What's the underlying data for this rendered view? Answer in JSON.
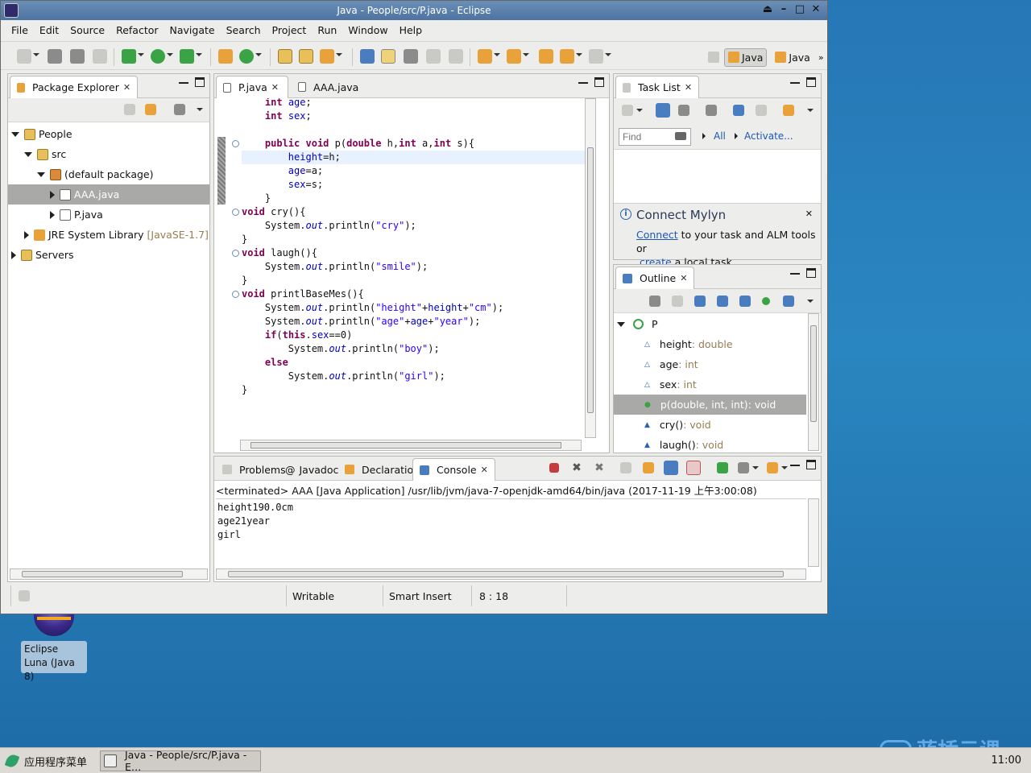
{
  "window": {
    "title": "Java - People/src/P.java - Eclipse",
    "controls": [
      "⏏",
      "–",
      "□",
      "✕"
    ]
  },
  "menu": [
    {
      "label": "File"
    },
    {
      "label": "Edit"
    },
    {
      "label": "Source"
    },
    {
      "label": "Refactor"
    },
    {
      "label": "Navigate"
    },
    {
      "label": "Search"
    },
    {
      "label": "Project"
    },
    {
      "label": "Run"
    },
    {
      "label": "Window"
    },
    {
      "label": "Help"
    }
  ],
  "perspectives": {
    "java_1": "Java",
    "java_2": "Java"
  },
  "package_explorer": {
    "title": "Package Explorer",
    "tree": {
      "project": "People",
      "src": "src",
      "package": "(default package)",
      "file_aaa": "AAA.java",
      "file_p": "P.java",
      "jre": "JRE System Library",
      "jre_version": "[JavaSE-1.7]",
      "servers": "Servers"
    }
  },
  "editor": {
    "tabs": [
      {
        "label": "P.java",
        "active": true
      },
      {
        "label": "AAA.java",
        "active": false
      }
    ],
    "lines": [
      "    int age;",
      "    int sex;",
      "",
      "    public void p(double h,int a,int s){",
      "        height=h;",
      "        age=a;",
      "        sex=s;",
      "    }",
      "void cry(){",
      "    System.out.println(\"cry\");",
      "}",
      "void laugh(){",
      "    System.out.println(\"smile\");",
      "}",
      "void printlBaseMes(){",
      "    System.out.println(\"height\"+height+\"cm\");",
      "    System.out.println(\"age\"+age+\"year\");",
      "    if(this.sex==0)",
      "        System.out.println(\"boy\");",
      "    else",
      "        System.out.println(\"girl\");",
      "}"
    ]
  },
  "task_list": {
    "title": "Task List",
    "find_placeholder": "Find",
    "all": "All",
    "activate": "Activate...",
    "mylyn": {
      "heading": "Connect Mylyn",
      "connect": "Connect",
      "text1": " to your task and ALM tools or",
      "create": "create",
      "text2": " a local task."
    }
  },
  "outline": {
    "title": "Outline",
    "class_name": "P",
    "members": [
      {
        "name": "height",
        "type": " : double"
      },
      {
        "name": "age",
        "type": " : int"
      },
      {
        "name": "sex",
        "type": " : int"
      },
      {
        "name": "p(double, int, int)",
        "type": " : void"
      },
      {
        "name": "cry()",
        "type": " : void"
      },
      {
        "name": "laugh()",
        "type": " : void"
      }
    ]
  },
  "bottom_tabs": {
    "problems": "Problems",
    "javadoc": "Javadoc",
    "declaration": "Declaration",
    "console": "Console"
  },
  "console": {
    "description": "<terminated> AAA [Java Application] /usr/lib/jvm/java-7-openjdk-amd64/bin/java (2017-11-19 上午3:00:08)",
    "output": "height190.0cm\nage21year\ngirl"
  },
  "status": {
    "writable": "Writable",
    "insert_mode": "Smart Insert",
    "position": "8 : 18"
  },
  "desktop": {
    "icon_label": "Eclipse Luna (Java 8)"
  },
  "taskbar": {
    "start_menu": "应用程序菜单",
    "task_title": "Java - People/src/P.java - E…",
    "clock": "11:00"
  },
  "watermark": "蓝桥云课"
}
